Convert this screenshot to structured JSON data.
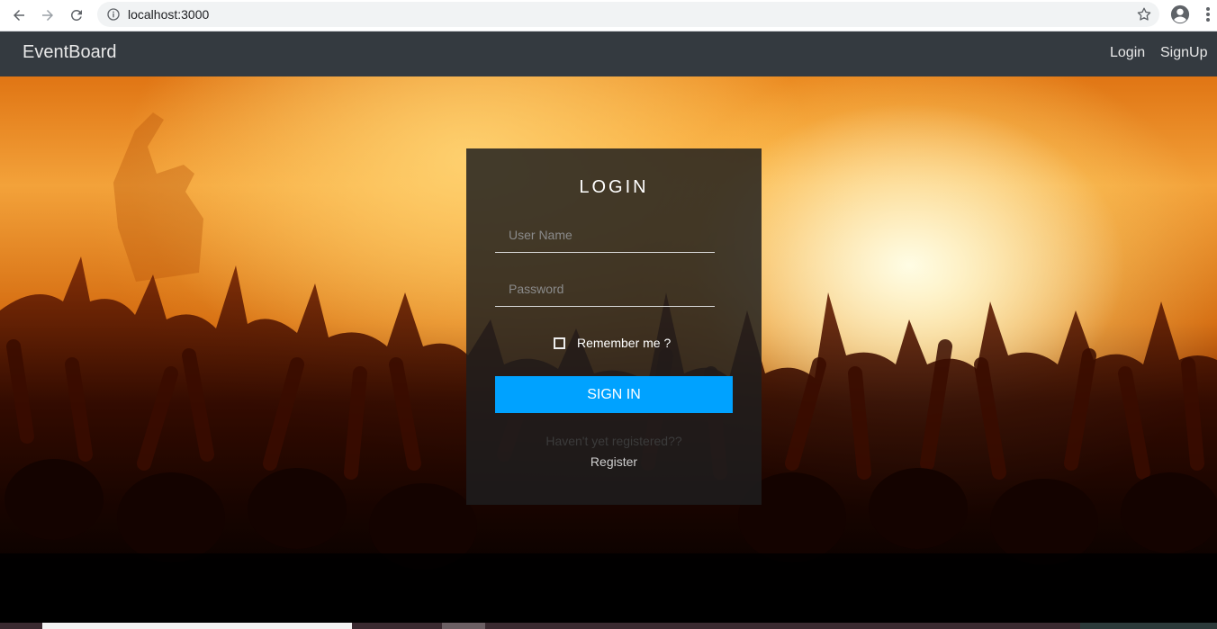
{
  "browser": {
    "url": "localhost:3000",
    "icons": {
      "back": "arrow-left-icon",
      "forward": "arrow-right-icon",
      "reload": "reload-icon",
      "info": "info-icon",
      "bookmark": "star-icon",
      "profile": "account-circle-icon",
      "menu": "kebab-menu-icon"
    }
  },
  "navbar": {
    "brand": "EventBoard",
    "links": [
      "Login",
      "SignUp"
    ],
    "background": "#343a40"
  },
  "login_card": {
    "title": "LOGIN",
    "username_placeholder": "User Name",
    "password_placeholder": "Password",
    "remember_label": "Remember me ?",
    "remember_checked": false,
    "submit_label": "SIGN IN",
    "submit_color": "#00a2ff",
    "not_registered_text": "Haven't yet registered??",
    "register_label": "Register"
  }
}
